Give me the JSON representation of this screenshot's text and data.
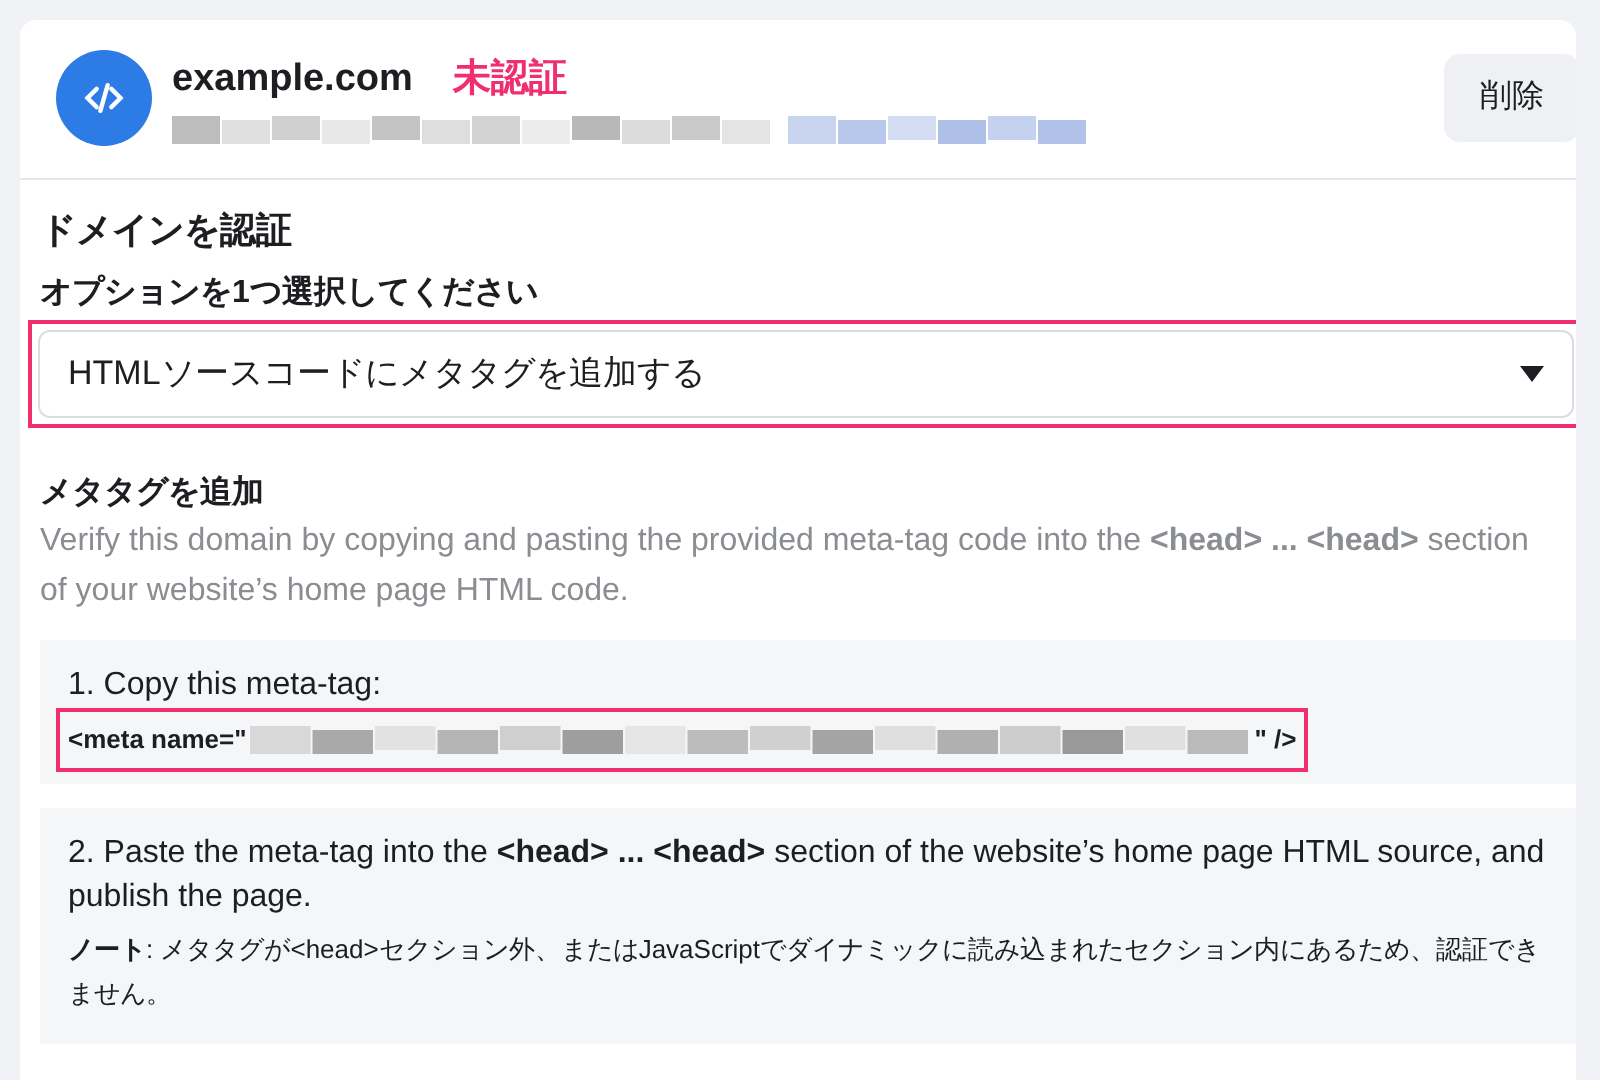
{
  "domain": {
    "name": "example.com",
    "status": "未認証",
    "verified": false
  },
  "delete_button": "削除",
  "section_title": "ドメインを認証",
  "option_label": "オプションを1つ選択してください",
  "option_select": {
    "value": "HTMLソースコードにメタタグを追加する",
    "highlighted": true
  },
  "meta_section": {
    "title": "メタタグを追加",
    "description": "Verify this domain by copying and pasting the provided meta-tag code into the **<head> ... <head>** section of your website’s home page HTML code."
  },
  "steps": [
    {
      "kind": "copy",
      "text": "1. Copy this meta-tag:",
      "code_start": "<meta name=\"",
      "code_end": "\" />",
      "highlighted": true
    },
    {
      "kind": "paste",
      "text": "2. Paste the meta-tag into the **<head> ... <head>** section of the website’s home page HTML source, and publish the page.",
      "note_label": "ノート",
      "note": ": メタタグが<head>セクション外、またはJavaScriptでダイナミックに読み込まれたセクション内にあるため、認証できません。"
    }
  ]
}
